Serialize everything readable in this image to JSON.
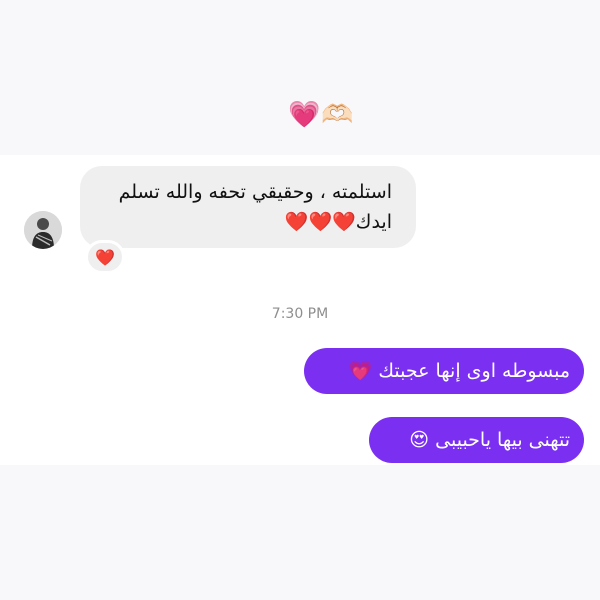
{
  "top_reaction": {
    "emojis": "💗🫶🏻"
  },
  "incoming_message": {
    "line1": "استلمته ، وحقيقي تحفه والله تسلم",
    "line2": "ايدك❤️❤️❤️"
  },
  "reaction": {
    "emoji": "❤️"
  },
  "timestamp": "7:30 PM",
  "outgoing_messages": [
    {
      "text": "مبسوطه اوى إنها عجبتك 💗"
    },
    {
      "text": "تتهنى بيها ياحبيبى 😍"
    }
  ],
  "colors": {
    "outgoing_bubble": "#7b2ff0",
    "incoming_bubble": "#efefef",
    "timestamp": "#8e8e8e",
    "page_background": "#f8f8fa"
  }
}
